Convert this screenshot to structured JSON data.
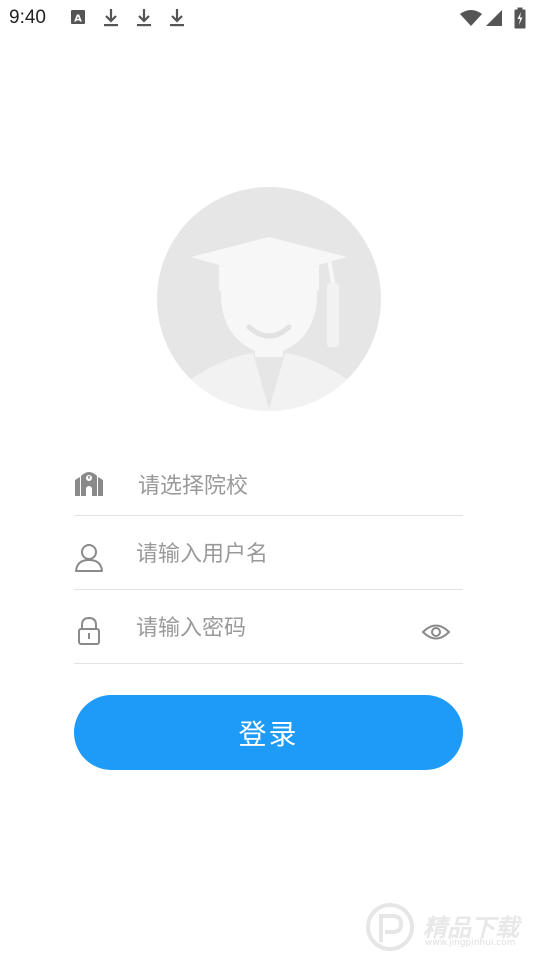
{
  "status_bar": {
    "time": "9:40"
  },
  "form": {
    "school_placeholder": "请选择院校",
    "username_placeholder": "请输入用户名",
    "password_placeholder": "请输入密码"
  },
  "actions": {
    "login_label": "登录"
  },
  "colors": {
    "primary": "#1e9bf7",
    "avatar_bg": "#e6e6e6",
    "icon_gray": "#8a8a8a",
    "divider": "#e3e3e3"
  },
  "icons": {
    "status": [
      "a-notification-icon",
      "download-icon",
      "download-icon",
      "download-icon",
      "wifi-icon",
      "signal-icon",
      "battery-icon"
    ],
    "fields": [
      "school-icon",
      "user-icon",
      "lock-icon",
      "eye-icon"
    ]
  },
  "watermark": {
    "title": "精品下载",
    "url": "www.jingpinhui.com"
  }
}
